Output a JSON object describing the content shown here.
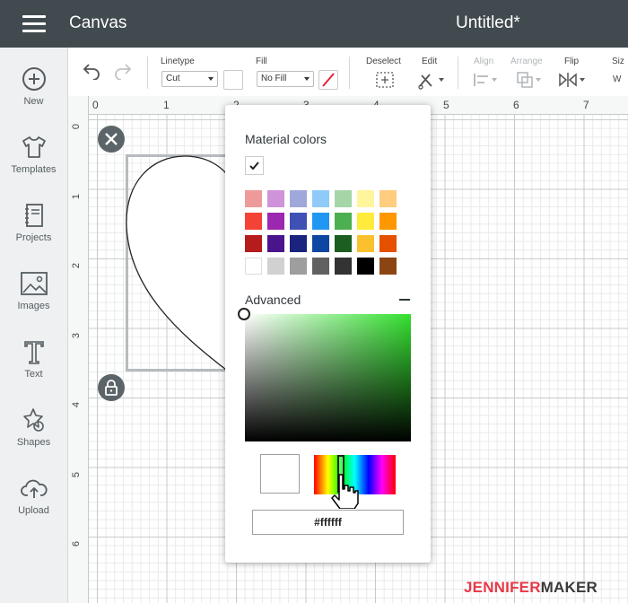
{
  "topbar": {
    "app_title": "Canvas",
    "doc_title": "Untitled*"
  },
  "sidebar": {
    "items": [
      {
        "label": "New",
        "icon": "plus-circle-icon"
      },
      {
        "label": "Templates",
        "icon": "tshirt-icon"
      },
      {
        "label": "Projects",
        "icon": "notebook-icon"
      },
      {
        "label": "Images",
        "icon": "image-icon"
      },
      {
        "label": "Text",
        "icon": "text-t-icon"
      },
      {
        "label": "Shapes",
        "icon": "shapes-icon"
      },
      {
        "label": "Upload",
        "icon": "cloud-upload-icon"
      }
    ]
  },
  "toolbar": {
    "linetype_label": "Linetype",
    "linetype_value": "Cut",
    "fill_label": "Fill",
    "fill_value": "No Fill",
    "deselect_label": "Deselect",
    "edit_label": "Edit",
    "align_label": "Align",
    "arrange_label": "Arrange",
    "flip_label": "Flip",
    "size_label": "Siz",
    "size_w": "W"
  },
  "ruler": {
    "top": [
      "0",
      "1",
      "2",
      "3",
      "4",
      "5",
      "6",
      "7"
    ],
    "left": [
      "0",
      "1",
      "2",
      "3",
      "4",
      "5",
      "6"
    ]
  },
  "color_popup": {
    "material_title": "Material colors",
    "advanced_title": "Advanced",
    "hex_value": "#ffffff",
    "swatch_rows": [
      [
        "#ef9a9a",
        "#ce93d8",
        "#9fa8da",
        "#90caf9",
        "#a5d6a7",
        "#fff59d",
        "#ffcc80"
      ],
      [
        "#f44336",
        "#9c27b0",
        "#3f51b5",
        "#2196f3",
        "#4caf50",
        "#ffeb3b",
        "#ff9800"
      ],
      [
        "#b71c1c",
        "#4a148c",
        "#1a237e",
        "#0d47a1",
        "#1b5e20",
        "#fbc02d",
        "#e65100"
      ],
      [
        "#ffffff",
        "#d1d1d1",
        "#9e9e9e",
        "#616161",
        "#333333",
        "#000000",
        "#8b4513"
      ]
    ]
  },
  "watermark": {
    "part1": "JENNIFER",
    "part2": "MAKER",
    "color1": "#e63946",
    "color2": "#3a3a3a"
  }
}
